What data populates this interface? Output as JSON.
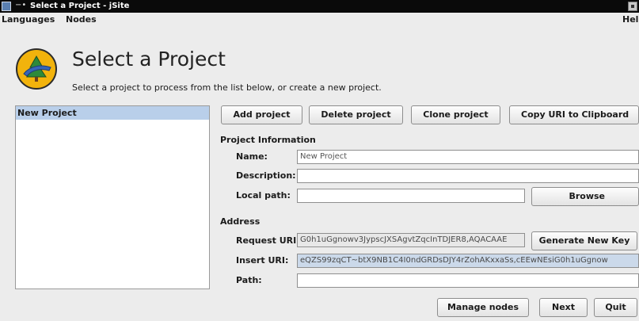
{
  "window": {
    "title": "Select a Project - jSite"
  },
  "menubar": {
    "languages": "Languages",
    "nodes": "Nodes",
    "help": "Hel"
  },
  "header": {
    "title": "Select a Project",
    "subtitle": "Select a project to process from the list below, or create a new project."
  },
  "project_list": {
    "items": [
      "New Project"
    ]
  },
  "toolbar": {
    "add": "Add project",
    "delete": "Delete project",
    "clone": "Clone project",
    "copy_uri": "Copy URI to Clipboard"
  },
  "project_info": {
    "heading": "Project Information",
    "name_label": "Name:",
    "name_value": "New Project",
    "description_label": "Description:",
    "description_value": "",
    "local_path_label": "Local path:",
    "local_path_value": "",
    "browse": "Browse"
  },
  "address": {
    "heading": "Address",
    "request_uri_label": "Request URI:",
    "request_uri_value": "G0h1uGgnowv3JypscJXSAgvtZqcInTDJER8,AQACAAE",
    "generate_key": "Generate New Key",
    "insert_uri_label": "Insert URI:",
    "insert_uri_value": "eQZS99zqCT~btX9NB1C4I0ndGRDsDJY4rZohAKxxaSs,cEEwNEsiG0h1uGgnow",
    "path_label": "Path:",
    "path_value": ""
  },
  "footer": {
    "manage_nodes": "Manage nodes",
    "next": "Next",
    "quit": "Quit"
  },
  "colors": {
    "selection": "#b9cfea",
    "logo": "#f2b30c",
    "titlebar": "#0a0a0a"
  }
}
